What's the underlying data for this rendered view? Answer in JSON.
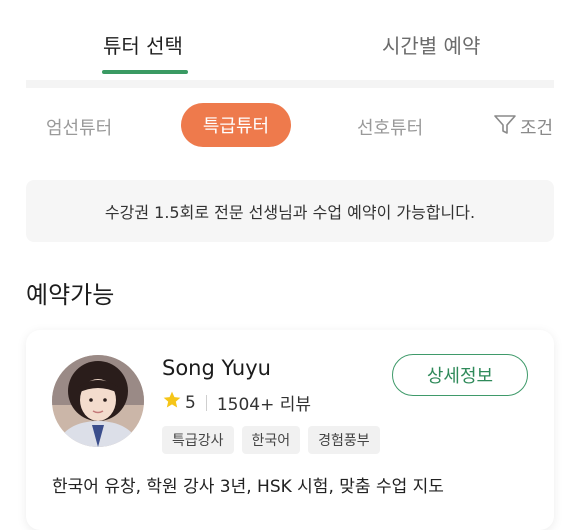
{
  "tabs": [
    {
      "label": "튜터 선택",
      "active": true
    },
    {
      "label": "시간별 예약",
      "active": false
    }
  ],
  "filters": {
    "items": [
      "엄선튜터",
      "특급튜터",
      "선호튜터"
    ],
    "selected": "특급튜터",
    "filter_label": "조건"
  },
  "notice": "수강권 1.5회로 전문 선생님과 수업 예약이 가능합니다.",
  "section_title": "예약가능",
  "tutor": {
    "name": "Song Yuyu",
    "rating": "5",
    "reviews": "1504+ 리뷰",
    "tags": [
      "특급강사",
      "한국어",
      "경험풍부"
    ],
    "detail_button": "상세정보",
    "description": "한국어 유창, 학원 강사 3년, HSK 시험, 맞춤 수업 지도"
  },
  "colors": {
    "accent_green": "#3a9a63",
    "accent_orange": "#ee7a4c",
    "star": "#f5c518"
  }
}
